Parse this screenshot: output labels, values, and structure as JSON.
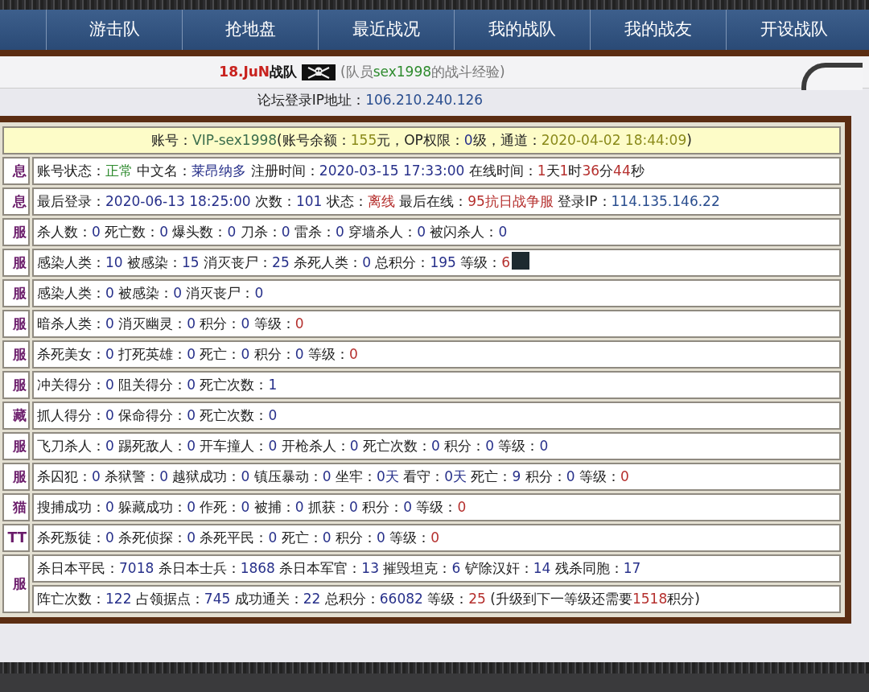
{
  "nav": {
    "items": [
      {
        "label": "游击队"
      },
      {
        "label": "抢地盘"
      },
      {
        "label": "最近战况"
      },
      {
        "label": "我的战队"
      },
      {
        "label": "我的战友"
      },
      {
        "label": "开设战队"
      }
    ]
  },
  "title": {
    "team": [
      {
        "text": "18.JuN",
        "color": "#c8221e",
        "bold": true
      },
      {
        "text": "战队",
        "color": "#111111",
        "bold": true
      }
    ],
    "subtitle": [
      {
        "text": "(队员",
        "color": "#777777"
      },
      {
        "text": "sex1998",
        "color": "#2e8b2e"
      },
      {
        "text": "的战斗经验)",
        "color": "#777777"
      }
    ]
  },
  "ip_line": [
    {
      "text": "论坛登录IP地址：",
      "color": "#222222"
    },
    {
      "text": "106.210.240.126",
      "color": "#2a4e8f"
    }
  ],
  "account_row": [
    {
      "text": "账号：",
      "color": "#222222"
    },
    {
      "text": "VIP-sex1998",
      "color": "#3b6d4c"
    },
    {
      "text": "(账号余额：",
      "color": "#222222"
    },
    {
      "text": "155",
      "color": "#8a8a1a"
    },
    {
      "text": "元，OP权限：",
      "color": "#222222"
    },
    {
      "text": "0",
      "color": "#27308a"
    },
    {
      "text": "级，通道：",
      "color": "#222222"
    },
    {
      "text": "2020-04-02 18:44:09",
      "color": "#8a8a1a"
    },
    {
      "text": ")",
      "color": "#222222"
    }
  ],
  "groups": [
    {
      "label": "息",
      "rows": [
        [
          {
            "text": "账号状态：",
            "color": "#222222"
          },
          {
            "text": "正常",
            "color": "#2e8b2e"
          },
          {
            "text": " 中文名：",
            "color": "#222222"
          },
          {
            "text": "莱昂纳多",
            "color": "#27308a"
          },
          {
            "text": " 注册时间：",
            "color": "#222222"
          },
          {
            "text": "2020-03-15 17:33:00",
            "color": "#27308a"
          },
          {
            "text": " 在线时间：",
            "color": "#222222"
          },
          {
            "text": "1",
            "color": "#b5302e"
          },
          {
            "text": "天",
            "color": "#222222"
          },
          {
            "text": "1",
            "color": "#b5302e"
          },
          {
            "text": "时",
            "color": "#222222"
          },
          {
            "text": "36",
            "color": "#b5302e"
          },
          {
            "text": "分",
            "color": "#222222"
          },
          {
            "text": "44",
            "color": "#b5302e"
          },
          {
            "text": "秒",
            "color": "#222222"
          }
        ]
      ]
    },
    {
      "label": "息",
      "rows": [
        [
          {
            "text": "最后登录：",
            "color": "#222222"
          },
          {
            "text": "2020-06-13 18:25:00",
            "color": "#27308a"
          },
          {
            "text": " 次数：",
            "color": "#222222"
          },
          {
            "text": "101",
            "color": "#27308a"
          },
          {
            "text": " 状态：",
            "color": "#222222"
          },
          {
            "text": "离线",
            "color": "#b5302e"
          },
          {
            "text": " 最后在线：",
            "color": "#222222"
          },
          {
            "text": "95抗日战争服",
            "color": "#b5302e"
          },
          {
            "text": " 登录IP：",
            "color": "#222222"
          },
          {
            "text": "114.135.146.22",
            "color": "#2a4e8f"
          }
        ]
      ]
    },
    {
      "label": "服",
      "rows": [
        [
          {
            "text": "杀人数：",
            "color": "#222222"
          },
          {
            "text": "0",
            "color": "#27308a"
          },
          {
            "text": " 死亡数：",
            "color": "#222222"
          },
          {
            "text": "0",
            "color": "#27308a"
          },
          {
            "text": " 爆头数：",
            "color": "#222222"
          },
          {
            "text": "0",
            "color": "#27308a"
          },
          {
            "text": " 刀杀：",
            "color": "#222222"
          },
          {
            "text": "0",
            "color": "#27308a"
          },
          {
            "text": " 雷杀：",
            "color": "#222222"
          },
          {
            "text": "0",
            "color": "#27308a"
          },
          {
            "text": " 穿墙杀人：",
            "color": "#222222"
          },
          {
            "text": "0",
            "color": "#27308a"
          },
          {
            "text": " 被闪杀人：",
            "color": "#222222"
          },
          {
            "text": "0",
            "color": "#27308a"
          }
        ]
      ]
    },
    {
      "label": "服",
      "rows": [
        [
          {
            "text": "感染人类：",
            "color": "#222222"
          },
          {
            "text": "10",
            "color": "#27308a"
          },
          {
            "text": " 被感染：",
            "color": "#222222"
          },
          {
            "text": "15",
            "color": "#27308a"
          },
          {
            "text": " 消灭丧尸：",
            "color": "#222222"
          },
          {
            "text": "25",
            "color": "#27308a"
          },
          {
            "text": " 杀死人类：",
            "color": "#222222"
          },
          {
            "text": "0",
            "color": "#27308a"
          },
          {
            "text": " 总积分：",
            "color": "#222222"
          },
          {
            "text": "195",
            "color": "#27308a"
          },
          {
            "text": " 等级：",
            "color": "#222222"
          },
          {
            "text": "6",
            "color": "#b5302e"
          },
          {
            "kind": "avatar"
          }
        ]
      ]
    },
    {
      "label": "服",
      "rows": [
        [
          {
            "text": "感染人类：",
            "color": "#222222"
          },
          {
            "text": "0",
            "color": "#27308a"
          },
          {
            "text": " 被感染：",
            "color": "#222222"
          },
          {
            "text": "0",
            "color": "#27308a"
          },
          {
            "text": " 消灭丧尸：",
            "color": "#222222"
          },
          {
            "text": "0",
            "color": "#27308a"
          }
        ]
      ]
    },
    {
      "label": "服",
      "rows": [
        [
          {
            "text": "暗杀人类：",
            "color": "#222222"
          },
          {
            "text": "0",
            "color": "#27308a"
          },
          {
            "text": " 消灭幽灵：",
            "color": "#222222"
          },
          {
            "text": "0",
            "color": "#27308a"
          },
          {
            "text": " 积分：",
            "color": "#222222"
          },
          {
            "text": "0",
            "color": "#27308a"
          },
          {
            "text": " 等级：",
            "color": "#222222"
          },
          {
            "text": "0",
            "color": "#b5302e"
          }
        ]
      ]
    },
    {
      "label": "服",
      "rows": [
        [
          {
            "text": "杀死美女：",
            "color": "#222222"
          },
          {
            "text": "0",
            "color": "#27308a"
          },
          {
            "text": " 打死英雄：",
            "color": "#222222"
          },
          {
            "text": "0",
            "color": "#27308a"
          },
          {
            "text": " 死亡：",
            "color": "#222222"
          },
          {
            "text": "0",
            "color": "#27308a"
          },
          {
            "text": " 积分：",
            "color": "#222222"
          },
          {
            "text": "0",
            "color": "#27308a"
          },
          {
            "text": " 等级：",
            "color": "#222222"
          },
          {
            "text": "0",
            "color": "#b5302e"
          }
        ]
      ]
    },
    {
      "label": "服",
      "rows": [
        [
          {
            "text": "冲关得分：",
            "color": "#222222"
          },
          {
            "text": "0",
            "color": "#27308a"
          },
          {
            "text": " 阻关得分：",
            "color": "#222222"
          },
          {
            "text": "0",
            "color": "#27308a"
          },
          {
            "text": " 死亡次数：",
            "color": "#222222"
          },
          {
            "text": "1",
            "color": "#27308a"
          }
        ]
      ]
    },
    {
      "label": "藏",
      "rows": [
        [
          {
            "text": "抓人得分：",
            "color": "#222222"
          },
          {
            "text": "0",
            "color": "#27308a"
          },
          {
            "text": " 保命得分：",
            "color": "#222222"
          },
          {
            "text": "0",
            "color": "#27308a"
          },
          {
            "text": " 死亡次数：",
            "color": "#222222"
          },
          {
            "text": "0",
            "color": "#27308a"
          }
        ]
      ]
    },
    {
      "label": "服",
      "rows": [
        [
          {
            "text": "飞刀杀人：",
            "color": "#222222"
          },
          {
            "text": "0",
            "color": "#27308a"
          },
          {
            "text": " 踢死敌人：",
            "color": "#222222"
          },
          {
            "text": "0",
            "color": "#27308a"
          },
          {
            "text": " 开车撞人：",
            "color": "#222222"
          },
          {
            "text": "0",
            "color": "#27308a"
          },
          {
            "text": " 开枪杀人：",
            "color": "#222222"
          },
          {
            "text": "0",
            "color": "#27308a"
          },
          {
            "text": " 死亡次数：",
            "color": "#222222"
          },
          {
            "text": "0",
            "color": "#27308a"
          },
          {
            "text": " 积分：",
            "color": "#222222"
          },
          {
            "text": "0",
            "color": "#27308a"
          },
          {
            "text": " 等级：",
            "color": "#222222"
          },
          {
            "text": "0",
            "color": "#27308a"
          }
        ]
      ]
    },
    {
      "label": "服",
      "rows": [
        [
          {
            "text": "杀囚犯：",
            "color": "#222222"
          },
          {
            "text": "0",
            "color": "#27308a"
          },
          {
            "text": " 杀狱警：",
            "color": "#222222"
          },
          {
            "text": "0",
            "color": "#27308a"
          },
          {
            "text": " 越狱成功：",
            "color": "#222222"
          },
          {
            "text": "0",
            "color": "#27308a"
          },
          {
            "text": " 镇压暴动：",
            "color": "#222222"
          },
          {
            "text": "0",
            "color": "#27308a"
          },
          {
            "text": " 坐牢：",
            "color": "#222222"
          },
          {
            "text": "0天",
            "color": "#27308a"
          },
          {
            "text": " 看守：",
            "color": "#222222"
          },
          {
            "text": "0天",
            "color": "#27308a"
          },
          {
            "text": " 死亡：",
            "color": "#222222"
          },
          {
            "text": "9",
            "color": "#27308a"
          },
          {
            "text": " 积分：",
            "color": "#222222"
          },
          {
            "text": "0",
            "color": "#27308a"
          },
          {
            "text": " 等级：",
            "color": "#222222"
          },
          {
            "text": "0",
            "color": "#b5302e"
          }
        ]
      ]
    },
    {
      "label": "猫",
      "rows": [
        [
          {
            "text": "搜捕成功：",
            "color": "#222222"
          },
          {
            "text": "0",
            "color": "#27308a"
          },
          {
            "text": " 躲藏成功：",
            "color": "#222222"
          },
          {
            "text": "0",
            "color": "#27308a"
          },
          {
            "text": " 作死：",
            "color": "#222222"
          },
          {
            "text": "0",
            "color": "#27308a"
          },
          {
            "text": " 被捕：",
            "color": "#222222"
          },
          {
            "text": "0",
            "color": "#27308a"
          },
          {
            "text": " 抓获：",
            "color": "#222222"
          },
          {
            "text": "0",
            "color": "#27308a"
          },
          {
            "text": " 积分：",
            "color": "#222222"
          },
          {
            "text": "0",
            "color": "#27308a"
          },
          {
            "text": " 等级：",
            "color": "#222222"
          },
          {
            "text": "0",
            "color": "#b5302e"
          }
        ]
      ]
    },
    {
      "label": "TT",
      "rows": [
        [
          {
            "text": "杀死叛徒：",
            "color": "#222222"
          },
          {
            "text": "0",
            "color": "#27308a"
          },
          {
            "text": " 杀死侦探：",
            "color": "#222222"
          },
          {
            "text": "0",
            "color": "#27308a"
          },
          {
            "text": " 杀死平民：",
            "color": "#222222"
          },
          {
            "text": "0",
            "color": "#27308a"
          },
          {
            "text": " 死亡：",
            "color": "#222222"
          },
          {
            "text": "0",
            "color": "#27308a"
          },
          {
            "text": " 积分：",
            "color": "#222222"
          },
          {
            "text": "0",
            "color": "#27308a"
          },
          {
            "text": " 等级：",
            "color": "#222222"
          },
          {
            "text": "0",
            "color": "#b5302e"
          }
        ]
      ]
    },
    {
      "label": "服",
      "rows": [
        [
          {
            "text": "杀日本平民：",
            "color": "#222222"
          },
          {
            "text": "7018",
            "color": "#27308a"
          },
          {
            "text": " 杀日本士兵：",
            "color": "#222222"
          },
          {
            "text": "1868",
            "color": "#27308a"
          },
          {
            "text": " 杀日本军官：",
            "color": "#222222"
          },
          {
            "text": "13",
            "color": "#27308a"
          },
          {
            "text": " 摧毁坦克：",
            "color": "#222222"
          },
          {
            "text": "6",
            "color": "#27308a"
          },
          {
            "text": " 铲除汉奸：",
            "color": "#222222"
          },
          {
            "text": "14",
            "color": "#27308a"
          },
          {
            "text": " 残杀同胞：",
            "color": "#222222"
          },
          {
            "text": "17",
            "color": "#27308a"
          }
        ],
        [
          {
            "text": "阵亡次数：",
            "color": "#222222"
          },
          {
            "text": "122",
            "color": "#27308a"
          },
          {
            "text": " 占领据点：",
            "color": "#222222"
          },
          {
            "text": "745",
            "color": "#27308a"
          },
          {
            "text": " 成功通关：",
            "color": "#222222"
          },
          {
            "text": "22",
            "color": "#27308a"
          },
          {
            "text": " 总积分：",
            "color": "#222222"
          },
          {
            "text": "66082",
            "color": "#27308a"
          },
          {
            "text": " 等级：",
            "color": "#222222"
          },
          {
            "text": "25",
            "color": "#b5302e"
          },
          {
            "text": " (升级到下一等级还需要",
            "color": "#222222"
          },
          {
            "text": "1518",
            "color": "#b5302e"
          },
          {
            "text": "积分)",
            "color": "#222222"
          }
        ]
      ]
    }
  ]
}
